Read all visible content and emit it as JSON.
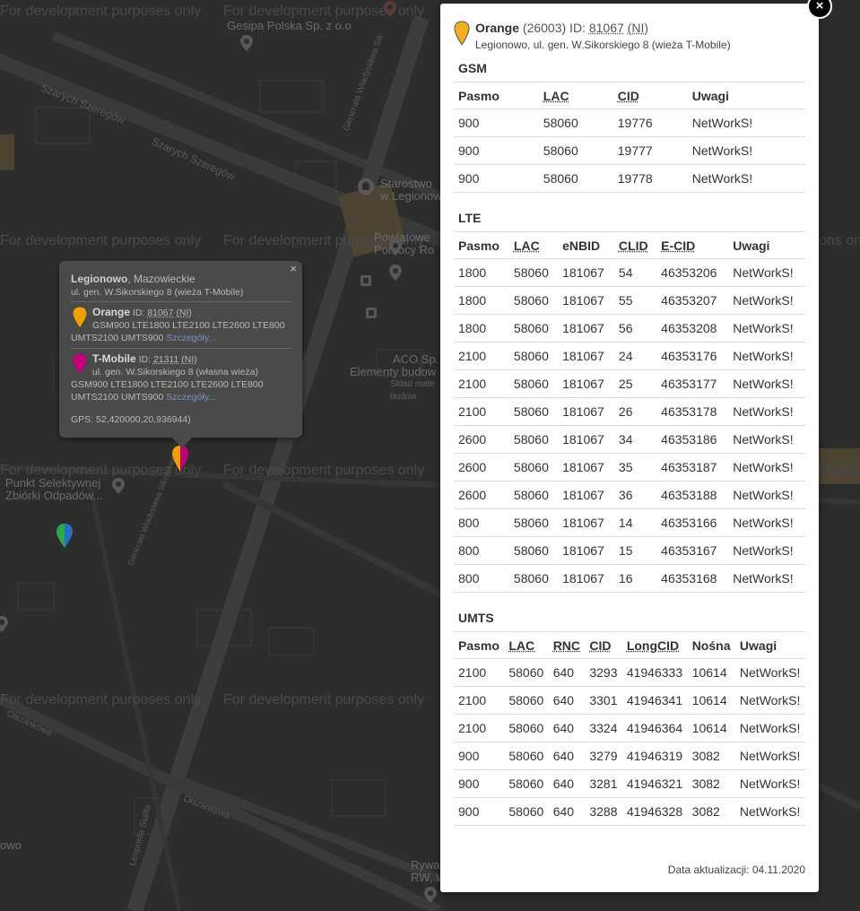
{
  "map": {
    "watermark": "For development purposes only",
    "labels": {
      "gesipa": "Gesipa Polska Sp. z o.o",
      "starostwo": "Starostwo\nw Legionow",
      "powiatowe": "Powiatowe\nPomocy Ro",
      "aco": "ACO Sp.",
      "elementy": "Elementy budow",
      "sklad": "Skład mate\nbudow",
      "punkt": "Punkt Selektywnej\nZbiórki Odpadów...",
      "owo": "owo",
      "rywa": "Rywa\nRW, W"
    },
    "streets": {
      "szarych1": "Szarych Szeregów",
      "szarych2": "Szarych Szeregów",
      "gen_sikorskiego": "Generała Władysława Sikorskiego",
      "gen_sikorskiego2": "Generała Władysława Sik",
      "leopolda": "Leopolda Staffa",
      "olszankowa": "Olszankowa",
      "olszankowa2": "Olszankowa",
      "olszankowa3": "Olszankowa"
    }
  },
  "bubble": {
    "city": "Legionowo",
    "region": ", Mazowieckie",
    "address": "ul. gen. W.Sikorskiego 8 (wieża T-Mobile)",
    "close": "×",
    "operators": [
      {
        "name": "Orange",
        "id_label": " ID: ",
        "id": "81067",
        "flag": "(NI)",
        "indent_bands": "GSM900 LTE1800 LTE2100 LTE2600 LTE800",
        "bands": "UMTS2100 UMTS900 ",
        "more": "Szczegóły..."
      },
      {
        "name": "T-Mobile",
        "id_label": " ID: ",
        "id": "21311",
        "flag": "(NI)",
        "addr": "ul. gen. W.Sikorskiego 8 (własna wieża)",
        "bands1": "GSM900 LTE1800 LTE2100 LTE2600 LTE800",
        "bands2": "UMTS2100 UMTS900 ",
        "more": "Szczegóły..."
      }
    ],
    "gps": "GPS: 52,420000,20,936944)"
  },
  "panel": {
    "close": "×",
    "operator": "Orange",
    "net_code": " (26003) ID: ",
    "id": "81067",
    "flag": "(NI)",
    "address": "Legionowo, ul. gen. W.Sikorskiego 8 (wieża T-Mobile)",
    "gsm": {
      "title": "GSM",
      "headers": [
        "Pasmo",
        "LAC",
        "CID",
        "Uwagi"
      ],
      "rows": [
        [
          "900",
          "58060",
          "19776",
          "NetWorkS!"
        ],
        [
          "900",
          "58060",
          "19777",
          "NetWorkS!"
        ],
        [
          "900",
          "58060",
          "19778",
          "NetWorkS!"
        ]
      ]
    },
    "lte": {
      "title": "LTE",
      "headers": [
        "Pasmo",
        "LAC",
        "eNBID",
        "CLID",
        "E-CID",
        "Uwagi"
      ],
      "rows": [
        [
          "1800",
          "58060",
          "181067",
          "54",
          "46353206",
          "NetWorkS!"
        ],
        [
          "1800",
          "58060",
          "181067",
          "55",
          "46353207",
          "NetWorkS!"
        ],
        [
          "1800",
          "58060",
          "181067",
          "56",
          "46353208",
          "NetWorkS!"
        ],
        [
          "2100",
          "58060",
          "181067",
          "24",
          "46353176",
          "NetWorkS!"
        ],
        [
          "2100",
          "58060",
          "181067",
          "25",
          "46353177",
          "NetWorkS!"
        ],
        [
          "2100",
          "58060",
          "181067",
          "26",
          "46353178",
          "NetWorkS!"
        ],
        [
          "2600",
          "58060",
          "181067",
          "34",
          "46353186",
          "NetWorkS!"
        ],
        [
          "2600",
          "58060",
          "181067",
          "35",
          "46353187",
          "NetWorkS!"
        ],
        [
          "2600",
          "58060",
          "181067",
          "36",
          "46353188",
          "NetWorkS!"
        ],
        [
          "800",
          "58060",
          "181067",
          "14",
          "46353166",
          "NetWorkS!"
        ],
        [
          "800",
          "58060",
          "181067",
          "15",
          "46353167",
          "NetWorkS!"
        ],
        [
          "800",
          "58060",
          "181067",
          "16",
          "46353168",
          "NetWorkS!"
        ]
      ]
    },
    "umts": {
      "title": "UMTS",
      "headers": [
        "Pasmo",
        "LAC",
        "RNC",
        "CID",
        "LongCID",
        "Nośna",
        "Uwagi"
      ],
      "rows": [
        [
          "2100",
          "58060",
          "640",
          "3293",
          "41946333",
          "10614",
          "NetWorkS!"
        ],
        [
          "2100",
          "58060",
          "640",
          "3301",
          "41946341",
          "10614",
          "NetWorkS!"
        ],
        [
          "2100",
          "58060",
          "640",
          "3324",
          "41946364",
          "10614",
          "NetWorkS!"
        ],
        [
          "900",
          "58060",
          "640",
          "3279",
          "41946319",
          "3082",
          "NetWorkS!"
        ],
        [
          "900",
          "58060",
          "640",
          "3281",
          "41946321",
          "3082",
          "NetWorkS!"
        ],
        [
          "900",
          "58060",
          "640",
          "3288",
          "41946328",
          "3082",
          "NetWorkS!"
        ]
      ]
    },
    "footer": "Data aktualizacji: 04.11.2020"
  },
  "colors": {
    "orange_pin": "#f0a000",
    "tmobile_pin": "#c2007a",
    "map_bg": "#2d2d2e"
  }
}
